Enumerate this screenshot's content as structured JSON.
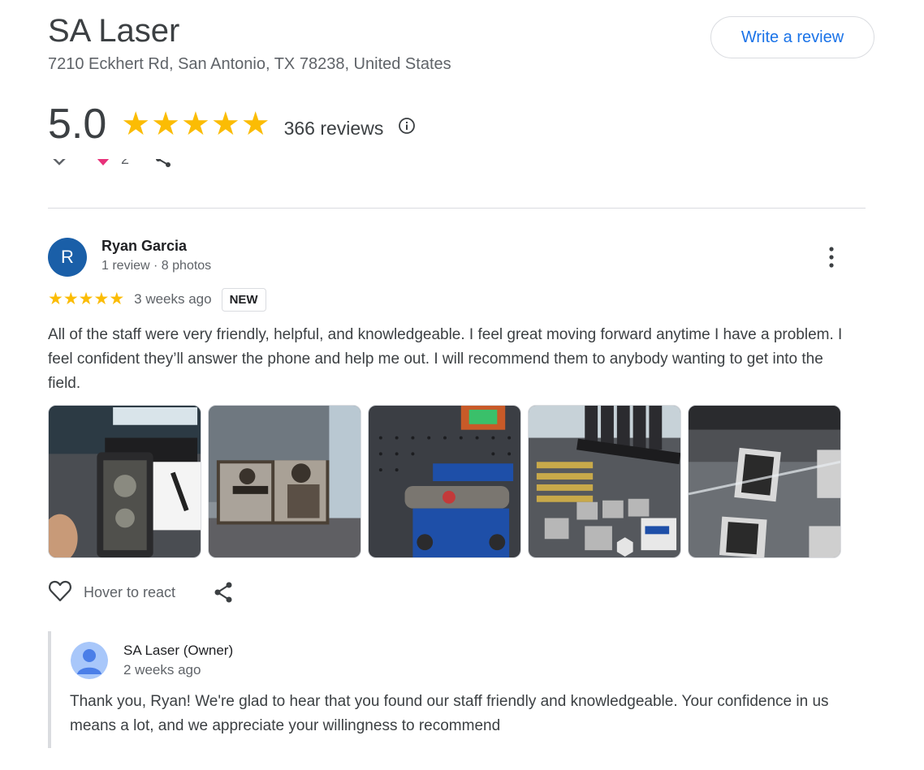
{
  "business": {
    "name": "SA Laser",
    "address": "7210 Eckhert Rd, San Antonio, TX 78238, United States",
    "write_review_label": "Write a review",
    "rating": "5.0",
    "stars": 5,
    "review_count": "366 reviews",
    "info_icon": "info-icon"
  },
  "previous_review": {
    "like_count": "2"
  },
  "review": {
    "avatar_letter": "R",
    "avatar_color": "#1a5fa8",
    "reviewer_name": "Ryan Garcia",
    "reviewer_meta": "1 review · 8 photos",
    "stars": 5,
    "time": "3 weeks ago",
    "badge": "NEW",
    "text": "All of the staff were very friendly, helpful, and knowledgeable. I feel great moving forward anytime I have a problem. I feel confident they’ll answer the phone and help me out. I will recommend them to anybody wanting to get into the field.",
    "photos": [
      "photo-1",
      "photo-2",
      "photo-3",
      "photo-4",
      "photo-5"
    ],
    "react_label": "Hover to react"
  },
  "owner_response": {
    "name": "SA Laser (Owner)",
    "time": "2 weeks ago",
    "text": "Thank you, Ryan! We're glad to hear that you found our staff friendly and knowledgeable. Your confidence in us means a lot, and we appreciate your willingness to recommend"
  },
  "colors": {
    "star": "#fbbc04",
    "accent_link": "#1a73e8",
    "divider": "#dadce0",
    "heart_pink": "#e8317a"
  }
}
